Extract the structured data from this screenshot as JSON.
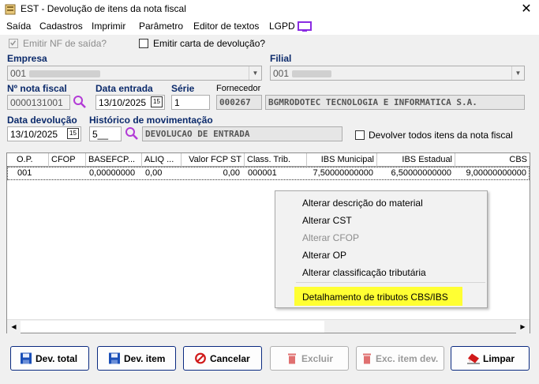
{
  "window": {
    "title": "EST - Devolução de itens da nota fiscal",
    "close_glyph": "✕"
  },
  "menu": {
    "items": [
      "Saída",
      "Cadastros",
      "Imprimir",
      "Parâmetro",
      "Editor de textos",
      "LGPD"
    ]
  },
  "options": {
    "emitir_nf_label": "Emitir NF de saída?",
    "emitir_nf_checked": true,
    "emitir_carta_label": "Emitir carta de devolução?",
    "emitir_carta_checked": false
  },
  "empresa": {
    "label": "Empresa",
    "value": "001"
  },
  "filial": {
    "label": "Filial",
    "value": "001"
  },
  "nota": {
    "numero_label": "Nº nota fiscal",
    "numero_value": "0000131001",
    "data_entrada_label": "Data entrada",
    "data_entrada_value": "13/10/2025",
    "serie_label": "Série",
    "serie_value": "1",
    "fornecedor_label": "Fornecedor",
    "fornecedor_code": "000267",
    "fornecedor_name": "BGMRODOTEC TECNOLOGIA E INFORMATICA S.A."
  },
  "devolucao": {
    "data_label": "Data devolução",
    "data_value": "13/10/2025",
    "historico_label": "Histórico de movimentação",
    "historico_code": "5__",
    "historico_desc": "DEVOLUCAO DE ENTRADA",
    "todos_label": "Devolver todos itens da nota fiscal",
    "todos_checked": false
  },
  "calendar_glyph": "15",
  "grid": {
    "columns": [
      "O.P.",
      "CFOP",
      "BASEFCP...",
      "ALIQ ...",
      "Valor FCP ST",
      "Class. Trib.",
      "IBS Municipal",
      "IBS Estadual",
      "CBS"
    ],
    "rows": [
      [
        "001",
        "",
        "0,00000000",
        "0,00",
        "0,00",
        "000001",
        "7,50000000000",
        "6,50000000000",
        "9,00000000000"
      ]
    ]
  },
  "context_menu": {
    "items": [
      {
        "label": "Alterar descrição do material",
        "enabled": true
      },
      {
        "label": "Alterar CST",
        "enabled": true
      },
      {
        "label": "Alterar CFOP",
        "enabled": false
      },
      {
        "label": "Alterar OP",
        "enabled": true
      },
      {
        "label": "Alterar classificação tributária",
        "enabled": true
      },
      {
        "label": "Detalhamento de tributos CBS/IBS",
        "enabled": true,
        "highlighted": true
      }
    ]
  },
  "buttons": {
    "dev_total": "Dev. total",
    "dev_item": "Dev. item",
    "cancelar": "Cancelar",
    "excluir": "Excluir",
    "exc_item_dev": "Exc. item dev.",
    "limpar": "Limpar"
  },
  "colors": {
    "accent": "#0a2a80",
    "label_blue": "#0b2a6b",
    "highlight": "#ffff33",
    "cancel_red": "#d01818",
    "disabled_red": "#e07070",
    "lgpd_purple": "#8a2be2"
  }
}
